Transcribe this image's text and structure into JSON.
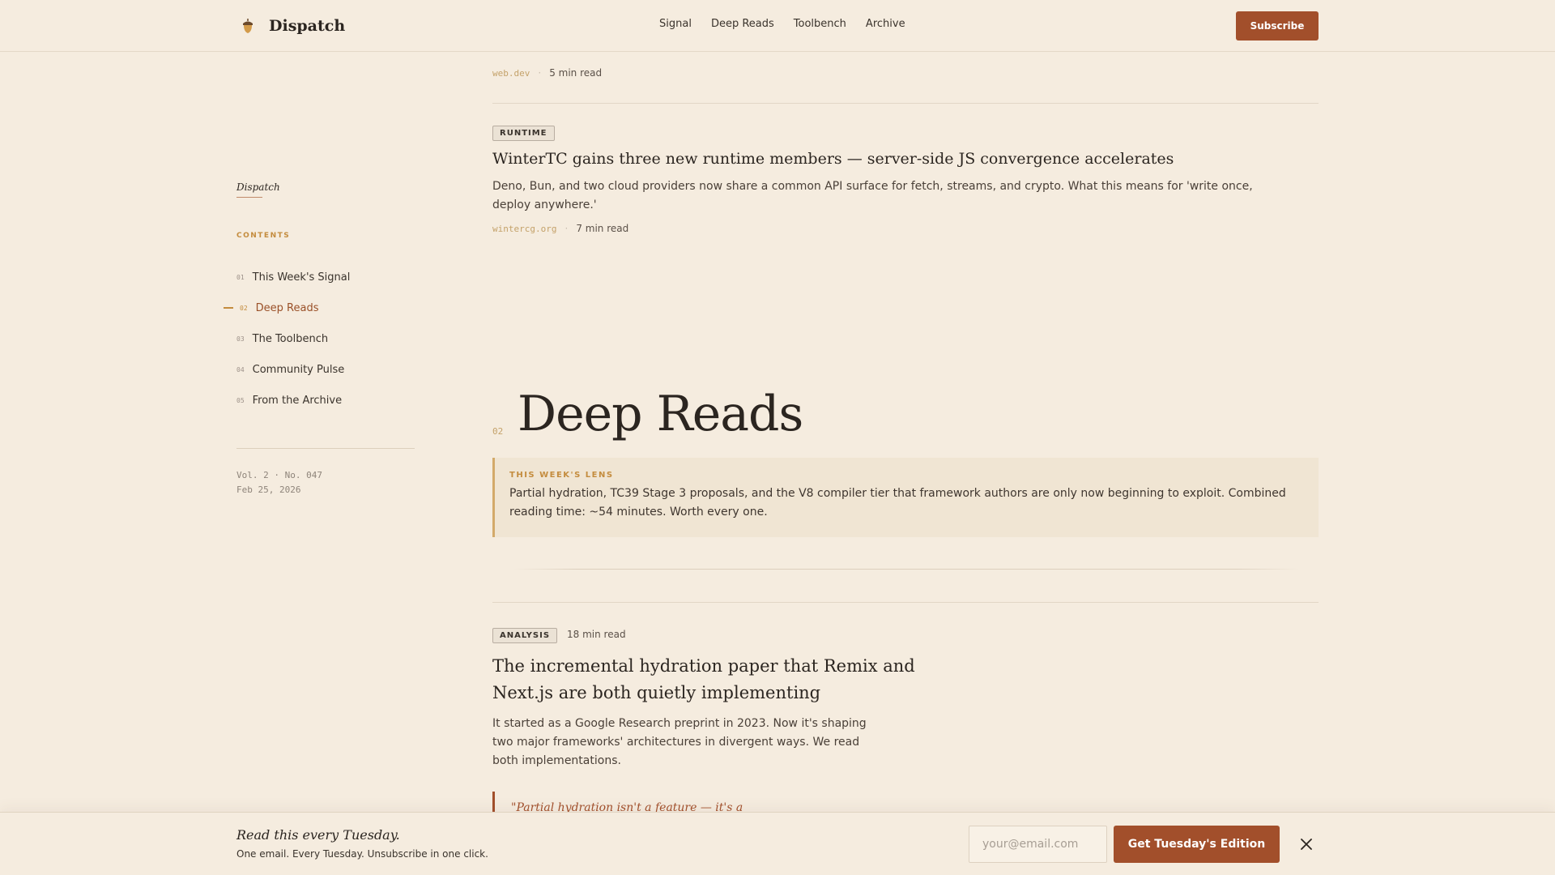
{
  "header": {
    "brand": "Dispatch",
    "nav": [
      "Signal",
      "Deep Reads",
      "Toolbench",
      "Archive"
    ],
    "subscribe_label": "Subscribe"
  },
  "sidebar": {
    "brand": "Dispatch",
    "contents_label": "CONTENTS",
    "items": [
      {
        "num": "01",
        "label": "This Week's Signal"
      },
      {
        "num": "02",
        "label": "Deep Reads"
      },
      {
        "num": "03",
        "label": "The Toolbench"
      },
      {
        "num": "04",
        "label": "Community Pulse"
      },
      {
        "num": "05",
        "label": "From the Archive"
      }
    ],
    "active_index": 1,
    "volume": "Vol. 2 · No. 047",
    "date": "Feb 25, 2026"
  },
  "main": {
    "prev_article": {
      "source": "web.dev",
      "read_time": "5 min read"
    },
    "runtime_article": {
      "tag": "RUNTIME",
      "title": "WinterTC gains three new runtime members — server-side JS convergence accelerates",
      "dek": "Deno, Bun, and two cloud providers now share a common API surface for fetch, streams, and crypto. What this means for 'write once, deploy anywhere.'",
      "source": "wintercg.org",
      "read_time": "7 min read"
    },
    "section": {
      "num": "02",
      "title": "Deep Reads"
    },
    "lens": {
      "label": "THIS WEEK'S LENS",
      "text": "Partial hydration, TC39 Stage 3 proposals, and the V8 compiler tier that framework authors are only now beginning to exploit. Combined reading time: ~54 minutes. Worth every one."
    },
    "analysis_article": {
      "tag": "ANALYSIS",
      "read_time": "18 min read",
      "title": "The incremental hydration paper that Remix and Next.js are both quietly implementing",
      "dek": "It started as a Google Research preprint in 2023. Now it's shaping two major frameworks' architectures in divergent ways. We read both implementations.",
      "quote": "\"Partial hydration isn't a feature — it's a"
    }
  },
  "bottom_bar": {
    "title": "Read this every Tuesday.",
    "subtitle": "One email. Every Tuesday. Unsubscribe in one click.",
    "email_placeholder": "your@email.com",
    "email_value": "",
    "cta_label": "Get Tuesday's Edition"
  },
  "colors": {
    "background": "#f5ecdf",
    "accent": "#a24f2b",
    "gold": "#c48c3e"
  },
  "icons": {
    "brand": "acorn-icon",
    "close": "close-icon"
  }
}
